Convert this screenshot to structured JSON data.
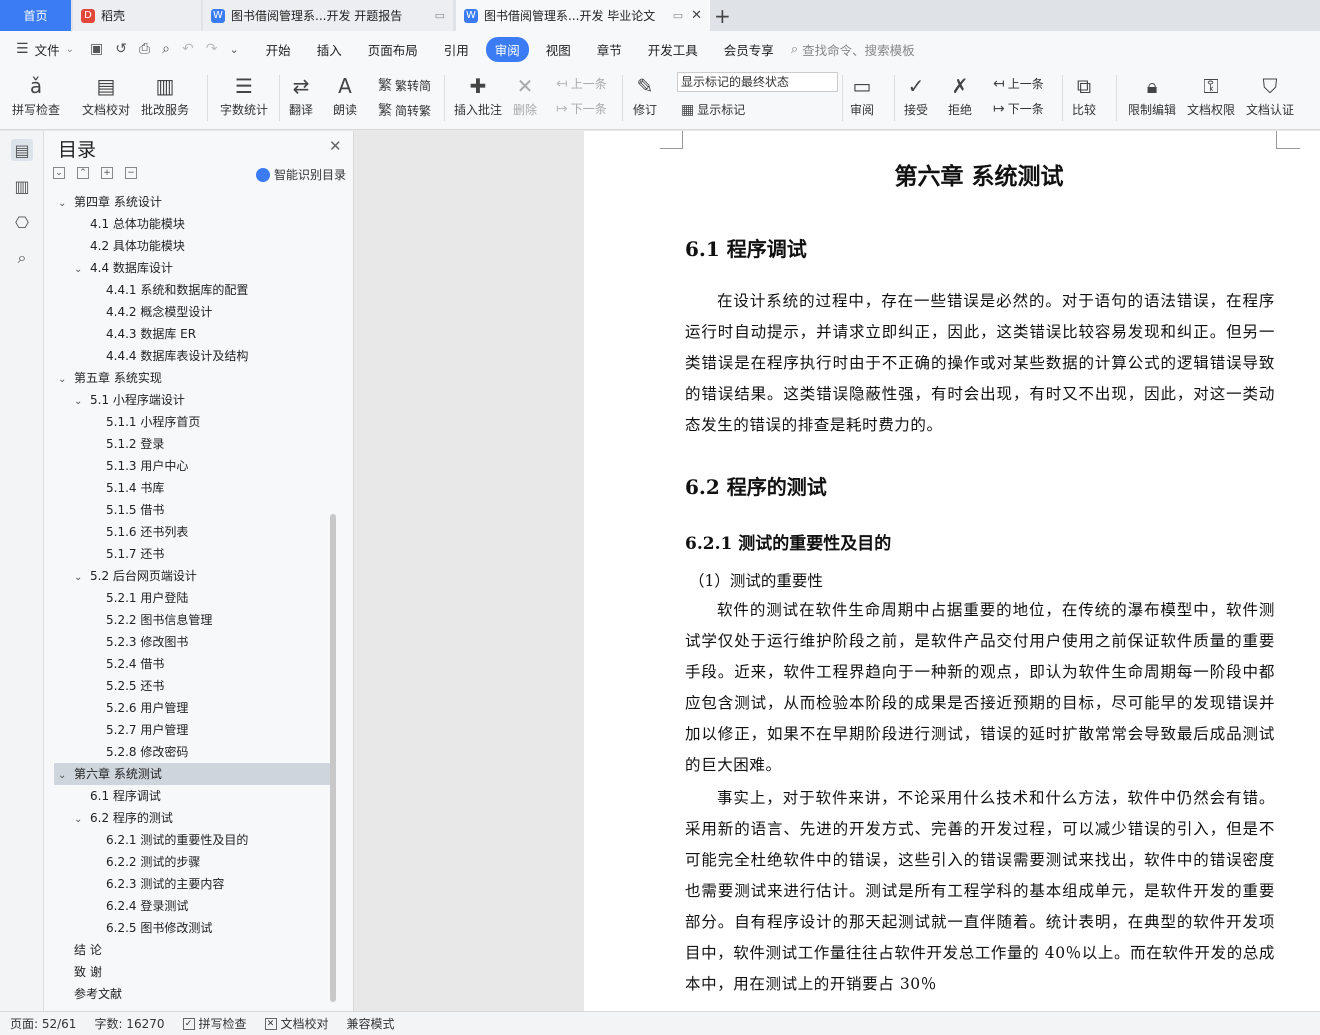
{
  "tabs": {
    "home": "首页",
    "daoke": "稻壳",
    "doc1": "图书借阅管理系...开发 开题报告",
    "doc2": "图书借阅管理系...开发 毕业论文",
    "add": "+"
  },
  "menu": {
    "file": "文件",
    "items": [
      "开始",
      "插入",
      "页面布局",
      "引用",
      "审阅",
      "视图",
      "章节",
      "开发工具",
      "会员专享"
    ],
    "search": "查找命令、搜索模板"
  },
  "toolbar": {
    "spellcheck": "拼写检查",
    "proofread": "文档校对",
    "review_service": "批改服务",
    "word_count": "字数统计",
    "translate": "翻译",
    "read_aloud": "朗读",
    "trad": "繁转简",
    "simp": "简转繁",
    "insert_comment": "插入批注",
    "delete": "删除",
    "prev_comment": "上一条",
    "next_comment": "下一条",
    "track": "修订",
    "markup_select": "显示标记的最终状态",
    "show_markup": "显示标记",
    "review_pane": "审阅",
    "accept": "接受",
    "reject": "拒绝",
    "prev": "上一条",
    "next": "下一条",
    "compare": "比较",
    "restrict": "限制编辑",
    "permission": "文档权限",
    "certify": "文档认证"
  },
  "toc": {
    "title": "目录",
    "smart": "智能识别目录",
    "items": [
      {
        "text": "第四章  系统设计",
        "level": 0,
        "arrow": "v"
      },
      {
        "text": "4.1  总体功能模块",
        "level": 1,
        "arrow": ""
      },
      {
        "text": "4.2  具体功能模块",
        "level": 1,
        "arrow": ""
      },
      {
        "text": "4.4  数据库设计",
        "level": 1,
        "arrow": "v"
      },
      {
        "text": "4.4.1 系统和数据库的配置",
        "level": 2,
        "arrow": ""
      },
      {
        "text": "4.4.2 概念模型设计",
        "level": 2,
        "arrow": ""
      },
      {
        "text": "4.4.3 数据库 ER",
        "level": 2,
        "arrow": ""
      },
      {
        "text": "4.4.4 数据库表设计及结构",
        "level": 2,
        "arrow": ""
      },
      {
        "text": "第五章  系统实现",
        "level": 0,
        "arrow": "v"
      },
      {
        "text": "5.1 小程序端设计",
        "level": 1,
        "arrow": "v"
      },
      {
        "text": "5.1.1 小程序首页",
        "level": 2,
        "arrow": ""
      },
      {
        "text": "5.1.2 登录",
        "level": 2,
        "arrow": ""
      },
      {
        "text": "5.1.3 用户中心",
        "level": 2,
        "arrow": ""
      },
      {
        "text": "5.1.4 书库",
        "level": 2,
        "arrow": ""
      },
      {
        "text": "5.1.5 借书",
        "level": 2,
        "arrow": ""
      },
      {
        "text": "5.1.6 还书列表",
        "level": 2,
        "arrow": ""
      },
      {
        "text": "5.1.7 还书",
        "level": 2,
        "arrow": ""
      },
      {
        "text": "5.2 后台网页端设计",
        "level": 1,
        "arrow": "v"
      },
      {
        "text": "5.2.1 用户登陆",
        "level": 2,
        "arrow": ""
      },
      {
        "text": "5.2.2 图书信息管理",
        "level": 2,
        "arrow": ""
      },
      {
        "text": "5.2.3 修改图书",
        "level": 2,
        "arrow": ""
      },
      {
        "text": "5.2.4  借书",
        "level": 2,
        "arrow": ""
      },
      {
        "text": "5.2.5  还书",
        "level": 2,
        "arrow": ""
      },
      {
        "text": "5.2.6 用户管理",
        "level": 2,
        "arrow": ""
      },
      {
        "text": "5.2.7 用户管理",
        "level": 2,
        "arrow": ""
      },
      {
        "text": "5.2.8 修改密码",
        "level": 2,
        "arrow": ""
      },
      {
        "text": "第六章  系统测试",
        "level": 0,
        "arrow": "v",
        "selected": true
      },
      {
        "text": "6.1  程序调试",
        "level": 1,
        "arrow": ""
      },
      {
        "text": "6.2  程序的测试",
        "level": 1,
        "arrow": "v"
      },
      {
        "text": "6.2.1  测试的重要性及目的",
        "level": 2,
        "arrow": ""
      },
      {
        "text": "6.2.2  测试的步骤",
        "level": 2,
        "arrow": ""
      },
      {
        "text": "6.2.3  测试的主要内容",
        "level": 2,
        "arrow": ""
      },
      {
        "text": "6.2.4 登录测试",
        "level": 2,
        "arrow": ""
      },
      {
        "text": "6.2.5 图书修改测试",
        "level": 2,
        "arrow": ""
      },
      {
        "text": "结    论",
        "level": 0,
        "arrow": ""
      },
      {
        "text": "致    谢",
        "level": 0,
        "arrow": ""
      },
      {
        "text": "参考文献",
        "level": 0,
        "arrow": ""
      }
    ]
  },
  "doc": {
    "chapter": "第六章  系统测试",
    "s61": "6.1  程序调试",
    "p1": "在设计系统的过程中，存在一些错误是必然的。对于语句的语法错误，在程序运行时自动提示，并请求立即纠正，因此，这类错误比较容易发现和纠正。但另一类错误是在程序执行时由于不正确的操作或对某些数据的计算公式的逻辑错误导致的错误结果。这类错误隐蔽性强，有时会出现，有时又不出现，因此，对这一类动态发生的错误的排查是耗时费力的。",
    "s62": "6.2  程序的测试",
    "s621": "6.2.1  测试的重要性及目的",
    "sub1": "（1）测试的重要性",
    "p2": "软件的测试在软件生命周期中占据重要的地位，在传统的瀑布模型中，软件测试学仅处于运行维护阶段之前，是软件产品交付用户使用之前保证软件质量的重要手段。近来，软件工程界趋向于一种新的观点，即认为软件生命周期每一阶段中都应包含测试，从而检验本阶段的成果是否接近预期的目标，尽可能早的发现错误并加以修正，如果不在早期阶段进行测试，错误的延时扩散常常会导致最后成品测试的巨大困难。",
    "p3": "事实上，对于软件来讲，不论采用什么技术和什么方法，软件中仍然会有错。采用新的语言、先进的开发方式、完善的开发过程，可以减少错误的引入，但是不可能完全杜绝软件中的错误，这些引入的错误需要测试来找出，软件中的错误密度也需要测试来进行估计。测试是所有工程学科的基本组成单元，是软件开发的重要部分。自有程序设计的那天起测试就一直伴随着。统计表明，在典型的软件开发项目中，软件测试工作量往往占软件开发总工作量的 40％以上。而在软件开发的总成本中，用在测试上的开销要占 30％"
  },
  "status": {
    "page": "页面: 52/61",
    "words": "字数: 16270",
    "spell": "拼写检查",
    "proof": "文档校对",
    "compat": "兼容模式"
  }
}
